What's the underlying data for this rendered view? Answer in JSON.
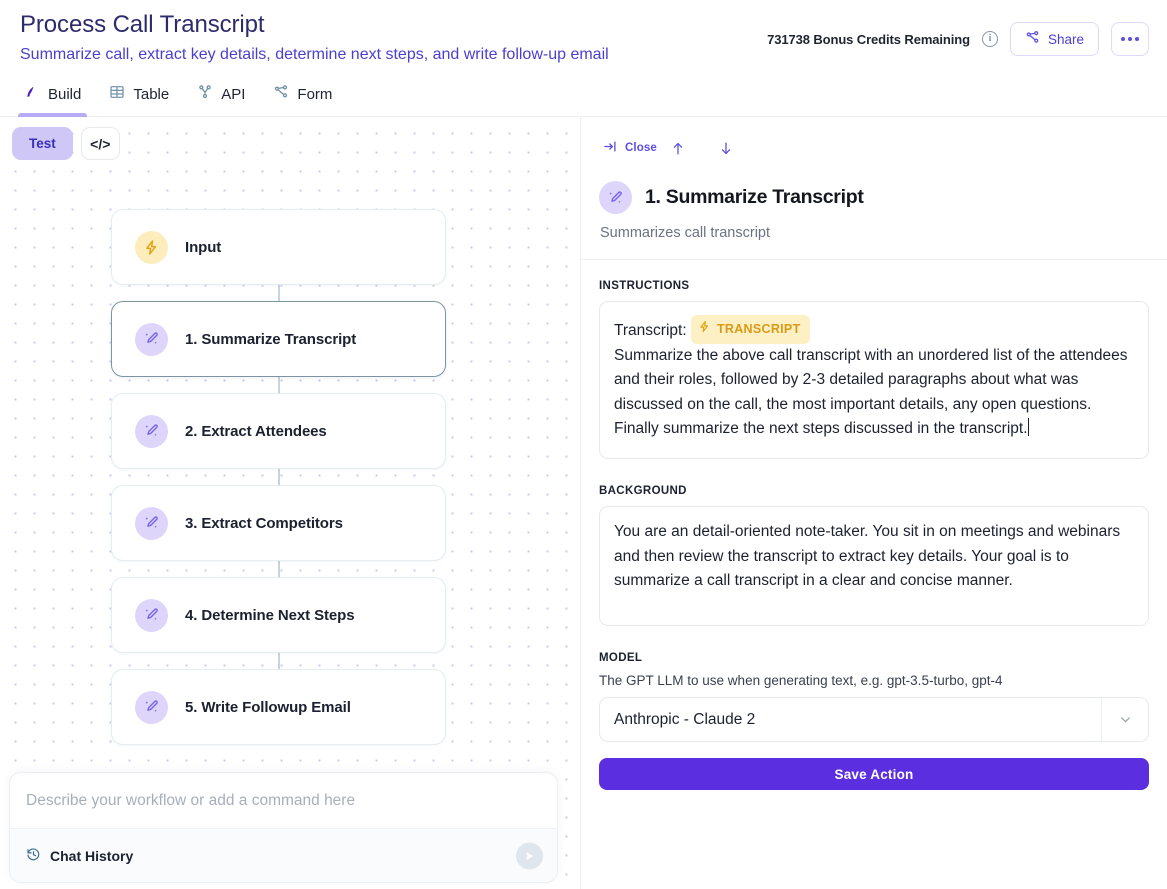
{
  "header": {
    "title": "Process Call Transcript",
    "subtitle": "Summarize call, extract key details, determine next steps, and write follow-up email",
    "credits_text": "731738 Bonus Credits Remaining",
    "info_glyph": "i",
    "share_label": "Share",
    "more_label": "•••"
  },
  "tabs": [
    {
      "label": "Build",
      "icon": "build-icon",
      "active": true
    },
    {
      "label": "Table",
      "icon": "table-icon",
      "active": false
    },
    {
      "label": "API",
      "icon": "api-icon",
      "active": false
    },
    {
      "label": "Form",
      "icon": "form-icon",
      "active": false
    }
  ],
  "canvas": {
    "test_label": "Test",
    "code_label": "</>",
    "nodes": [
      {
        "label": "Input",
        "icon": "lightning-icon",
        "tone": "yellow",
        "selected": false
      },
      {
        "label": "1. Summarize Transcript",
        "icon": "magic-pen-icon",
        "tone": "purple",
        "selected": true
      },
      {
        "label": "2. Extract Attendees",
        "icon": "magic-pen-icon",
        "tone": "purple",
        "selected": false
      },
      {
        "label": "3. Extract Competitors",
        "icon": "magic-pen-icon",
        "tone": "purple",
        "selected": false
      },
      {
        "label": "4. Determine Next Steps",
        "icon": "magic-pen-icon",
        "tone": "purple",
        "selected": false
      },
      {
        "label": "5. Write Followup Email",
        "icon": "magic-pen-icon",
        "tone": "purple",
        "selected": false
      }
    ]
  },
  "chat": {
    "placeholder": "Describe your workflow or add a command here",
    "value": "",
    "history_label": "Chat History"
  },
  "panel": {
    "close_label": "Close",
    "title": "1. Summarize Transcript",
    "description": "Summarizes call transcript",
    "instructions_label": "INSTRUCTIONS",
    "instructions_prefix": "Transcript: ",
    "instructions_chip": "TRANSCRIPT",
    "instructions_body": "Summarize the above call transcript with an unordered list of the attendees and their roles, followed by 2-3 detailed paragraphs about what was discussed on the call, the most important details, any open questions.  Finally summarize the next steps discussed in the transcript.",
    "background_label": "BACKGROUND",
    "background_body": "You are an detail-oriented note-taker. You sit in on meetings and webinars and then review the transcript to extract key details. Your goal is to summarize a call transcript in a clear and concise manner.",
    "model_label": "MODEL",
    "model_hint": "The GPT LLM to use when generating text, e.g. gpt-3.5-turbo, gpt-4",
    "model_value": "Anthropic - Claude 2",
    "save_label": "Save Action"
  },
  "colors": {
    "brand_purple": "#5b4ee0",
    "save_purple": "#5b2ee0",
    "title_indigo": "#2e2b6b",
    "accent_yellow": "#d99b16",
    "selected_border": "#7a95a1"
  }
}
